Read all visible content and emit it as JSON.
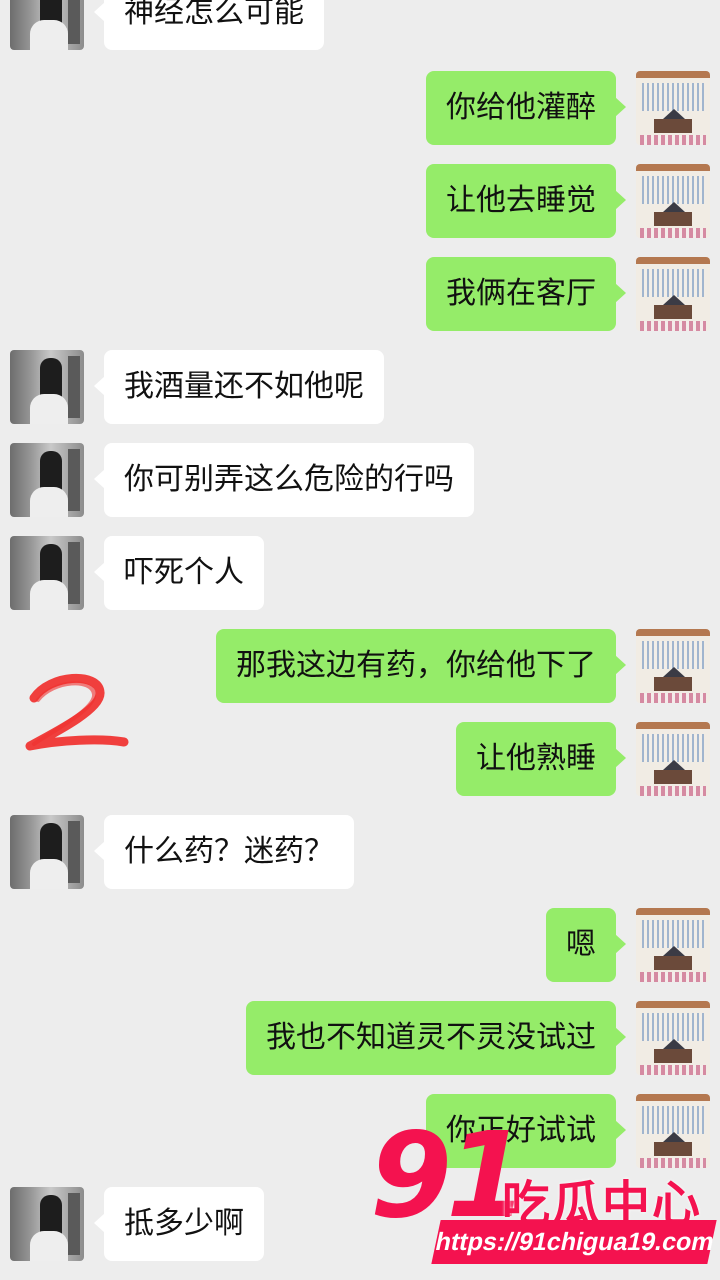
{
  "messages": [
    {
      "side": "left",
      "text": "神经怎么可能"
    },
    {
      "side": "right",
      "text": "你给他灌醉"
    },
    {
      "side": "right",
      "text": "让他去睡觉"
    },
    {
      "side": "right",
      "text": "我俩在客厅"
    },
    {
      "side": "left",
      "text": "我酒量还不如他呢"
    },
    {
      "side": "left",
      "text": "你可别弄这么危险的行吗"
    },
    {
      "side": "left",
      "text": "吓死个人"
    },
    {
      "side": "right",
      "text": "那我这边有药，你给他下了"
    },
    {
      "side": "right",
      "text": "让他熟睡"
    },
    {
      "side": "left",
      "text": "什么药？迷药？"
    },
    {
      "side": "right",
      "text": "嗯"
    },
    {
      "side": "right",
      "text": "我也不知道灵不灵没试过"
    },
    {
      "side": "right",
      "text": "你正好试试"
    },
    {
      "side": "left",
      "text": "抵多少啊"
    }
  ],
  "annotation": {
    "mark": "2",
    "color": "#f0302e"
  },
  "watermark": {
    "number": "91",
    "title": "吃瓜中心",
    "url": "https://91chigua19.com",
    "color": "#f4124f"
  },
  "colors": {
    "background": "#ededed",
    "sent_bubble": "#95ec69",
    "received_bubble": "#ffffff"
  }
}
